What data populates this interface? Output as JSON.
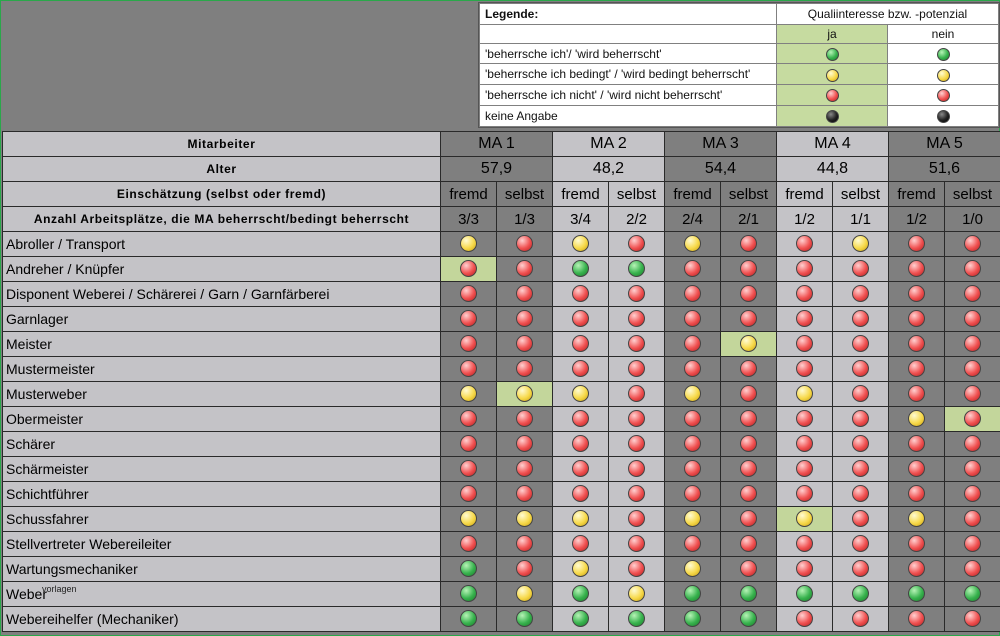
{
  "legend": {
    "title": "Legende:",
    "header": "Qualiinteresse bzw. -potenzial",
    "col_ja": "ja",
    "col_nein": "nein",
    "rows": [
      {
        "label": "'beherrsche ich'/ 'wird beherrscht'",
        "color": "green"
      },
      {
        "label": "'beherrsche ich bedingt' / 'wird bedingt beherrscht'",
        "color": "yellow"
      },
      {
        "label": "'beherrsche ich nicht' / 'wird nicht beherrscht'",
        "color": "red"
      },
      {
        "label": "keine Angabe",
        "color": "black"
      }
    ]
  },
  "header": {
    "mitarbeiter_label": "Mitarbeiter",
    "alter_label": "Alter",
    "einschaetzung_label": "Einschätzung (selbst oder fremd)",
    "anzahl_label": "Anzahl Arbeitsplätze, die MA beherrscht/bedingt beherrscht",
    "employees": [
      {
        "name": "MA 1",
        "age": "57,9",
        "fremd": "fremd",
        "selbst": "selbst",
        "count_fremd": "3/3",
        "count_selbst": "1/3"
      },
      {
        "name": "MA 2",
        "age": "48,2",
        "fremd": "fremd",
        "selbst": "selbst",
        "count_fremd": "3/4",
        "count_selbst": "2/2"
      },
      {
        "name": "MA 3",
        "age": "54,4",
        "fremd": "fremd",
        "selbst": "selbst",
        "count_fremd": "2/4",
        "count_selbst": "2/1"
      },
      {
        "name": "MA 4",
        "age": "44,8",
        "fremd": "fremd",
        "selbst": "selbst",
        "count_fremd": "1/2",
        "count_selbst": "1/1"
      },
      {
        "name": "MA 5",
        "age": "51,6",
        "fremd": "fremd",
        "selbst": "selbst",
        "count_fremd": "1/2",
        "count_selbst": "1/0"
      }
    ]
  },
  "status_colors": {
    "green": "#37b24d",
    "yellow": "#f7d94a",
    "red": "#f05050",
    "black": "#222222",
    "highlight": "#c3d69b"
  },
  "rows": [
    {
      "label": "Abroller / Transport",
      "cells": [
        "Y",
        "R",
        "Y",
        "R",
        "Y",
        "R",
        "R",
        "Y",
        "R",
        "R"
      ],
      "highlight": []
    },
    {
      "label": "Andreher / Knüpfer",
      "cells": [
        "R",
        "R",
        "G",
        "G",
        "R",
        "R",
        "R",
        "R",
        "R",
        "R"
      ],
      "highlight": [
        0
      ]
    },
    {
      "label": "Disponent Weberei / Schärerei / Garn / Garnfärberei",
      "cells": [
        "R",
        "R",
        "R",
        "R",
        "R",
        "R",
        "R",
        "R",
        "R",
        "R"
      ],
      "highlight": []
    },
    {
      "label": "Garnlager",
      "cells": [
        "R",
        "R",
        "R",
        "R",
        "R",
        "R",
        "R",
        "R",
        "R",
        "R"
      ],
      "highlight": []
    },
    {
      "label": "Meister",
      "cells": [
        "R",
        "R",
        "R",
        "R",
        "R",
        "Y",
        "R",
        "R",
        "R",
        "R"
      ],
      "highlight": [
        5
      ]
    },
    {
      "label": "Mustermeister",
      "cells": [
        "R",
        "R",
        "R",
        "R",
        "R",
        "R",
        "R",
        "R",
        "R",
        "R"
      ],
      "highlight": []
    },
    {
      "label": "Musterweber",
      "cells": [
        "Y",
        "Y",
        "Y",
        "R",
        "Y",
        "R",
        "Y",
        "R",
        "R",
        "R"
      ],
      "highlight": [
        1
      ]
    },
    {
      "label": "Obermeister",
      "cells": [
        "R",
        "R",
        "R",
        "R",
        "R",
        "R",
        "R",
        "R",
        "Y",
        "R"
      ],
      "highlight": [
        9
      ]
    },
    {
      "label": "Schärer",
      "cells": [
        "R",
        "R",
        "R",
        "R",
        "R",
        "R",
        "R",
        "R",
        "R",
        "R"
      ],
      "highlight": []
    },
    {
      "label": "Schärmeister",
      "cells": [
        "R",
        "R",
        "R",
        "R",
        "R",
        "R",
        "R",
        "R",
        "R",
        "R"
      ],
      "highlight": []
    },
    {
      "label": "Schichtführer",
      "cells": [
        "R",
        "R",
        "R",
        "R",
        "R",
        "R",
        "R",
        "R",
        "R",
        "R"
      ],
      "highlight": []
    },
    {
      "label": "Schussfahrer",
      "cells": [
        "Y",
        "Y",
        "Y",
        "R",
        "Y",
        "R",
        "Y",
        "R",
        "Y",
        "R"
      ],
      "highlight": [
        6
      ]
    },
    {
      "label": "Stellvertreter Webereileiter",
      "cells": [
        "R",
        "R",
        "R",
        "R",
        "R",
        "R",
        "R",
        "R",
        "R",
        "R"
      ],
      "highlight": []
    },
    {
      "label": "Wartungsmechaniker",
      "cells": [
        "G",
        "R",
        "Y",
        "R",
        "Y",
        "R",
        "R",
        "R",
        "R",
        "R"
      ],
      "highlight": []
    },
    {
      "label": "Weber",
      "cells": [
        "G",
        "Y",
        "G",
        "Y",
        "G",
        "G",
        "G",
        "G",
        "G",
        "G"
      ],
      "highlight": []
    },
    {
      "label": "Webereihelfer (Mechaniker)",
      "cells": [
        "G",
        "G",
        "G",
        "G",
        "G",
        "G",
        "R",
        "R",
        "R",
        "R"
      ],
      "highlight": []
    }
  ],
  "watermark": "vorlagen"
}
